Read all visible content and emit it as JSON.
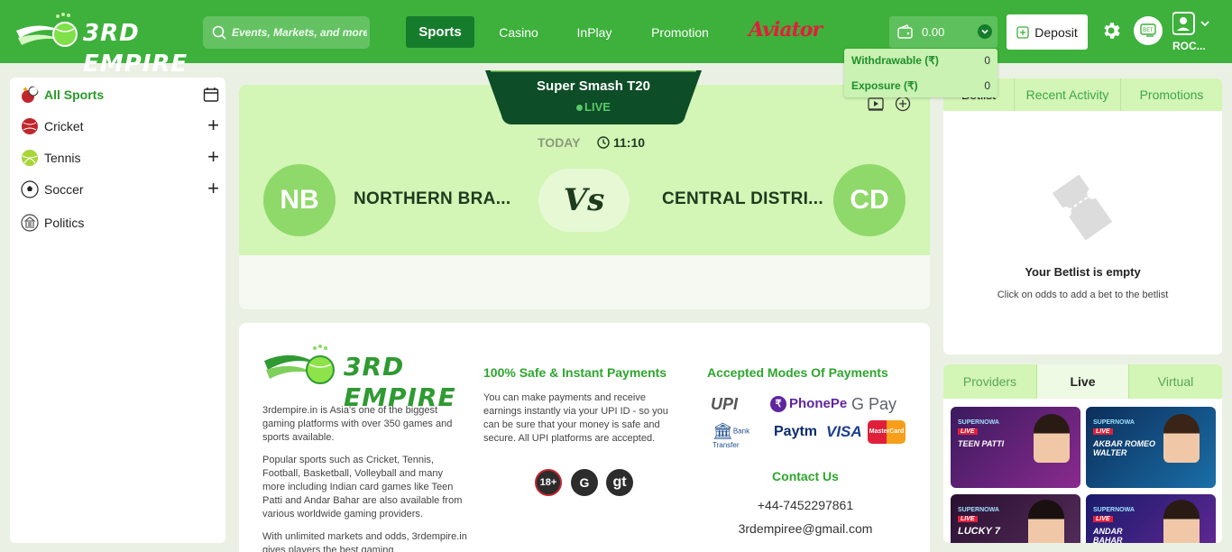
{
  "header": {
    "logo_text": "3RD EMPIRE",
    "search_placeholder": "Events, Markets, and more",
    "nav": [
      {
        "label": "Sports",
        "active": true
      },
      {
        "label": "Casino",
        "active": false
      },
      {
        "label": "InPlay",
        "active": false
      },
      {
        "label": "Promotion",
        "active": false
      }
    ],
    "aviator": "Aviator",
    "balance": "0.00",
    "deposit": "Deposit",
    "username": "ROC..."
  },
  "wallet_dropdown": {
    "withdrawable_label": "Withdrawable (₹)",
    "withdrawable_value": "0",
    "exposure_label": "Exposure (₹)",
    "exposure_value": "0"
  },
  "sidebar": {
    "all_sports": "All Sports",
    "items": [
      {
        "label": "Cricket",
        "icon": "cricket-ball-icon",
        "expandable": true
      },
      {
        "label": "Tennis",
        "icon": "tennis-ball-icon",
        "expandable": true
      },
      {
        "label": "Soccer",
        "icon": "soccer-ball-icon",
        "expandable": true
      },
      {
        "label": "Politics",
        "icon": "parliament-icon",
        "expandable": false
      }
    ]
  },
  "match": {
    "tournament": "Super Smash T20",
    "live": "LIVE",
    "day": "TODAY",
    "time": "11:10",
    "home_abbr": "NB",
    "home_name": "NORTHERN BRA...",
    "away_abbr": "CD",
    "away_name": "CENTRAL DISTRI...",
    "vs": "Vs"
  },
  "betlist": {
    "tabs": [
      "Betlist",
      "Recent Activity",
      "Promotions"
    ],
    "empty_title": "Your Betlist is empty",
    "empty_sub": "Click on odds to add a bet to the betlist"
  },
  "providers": {
    "tabs": [
      "Providers",
      "Live",
      "Virtual"
    ],
    "active_tab": "Live",
    "games": [
      {
        "provider": "SUPERNOWA",
        "live": "LIVE",
        "title": "TEEN PATTI"
      },
      {
        "provider": "SUPERNOWA",
        "live": "LIVE",
        "title": "AKBAR ROMEO WALTER"
      },
      {
        "provider": "SUPERNOWA",
        "live": "LIVE",
        "title": "LUCKY 7"
      },
      {
        "provider": "SUPERNOWA",
        "live": "LIVE",
        "title": "ANDAR BAHAR"
      }
    ]
  },
  "footer": {
    "about_1": "3rdempire.in is Asia's one of the biggest gaming platforms with over 350 games and sports available.",
    "about_2": "Popular sports such as Cricket, Tennis, Football, Basketball, Volleyball and many more including Indian card games like Teen Patti and Andar Bahar are also available from various worldwide gaming providers.",
    "about_3": "With unlimited markets and odds, 3rdempire.in gives players the best gaming",
    "safe_title": "100% Safe & Instant Payments",
    "safe_text": "You can make payments and receive earnings instantly via your UPI ID - so you can be sure that your money is safe and secure. All UPI platforms are accepted.",
    "badges": [
      "18+",
      "G",
      "gt"
    ],
    "modes_title": "Accepted Modes Of Payments",
    "payments": [
      "UPI",
      "PhonePe",
      "G Pay",
      "Bank Transfer",
      "Paytm",
      "VISA",
      "MasterCard"
    ],
    "contact_title": "Contact Us",
    "phone": "+44-7452297861",
    "email": "3rdempiree@gmail.com"
  },
  "colors": {
    "brand_green": "#3db13b",
    "dark_green": "#157c2c",
    "light_green": "#d3f5b5",
    "aviator_red": "#e0203a"
  }
}
